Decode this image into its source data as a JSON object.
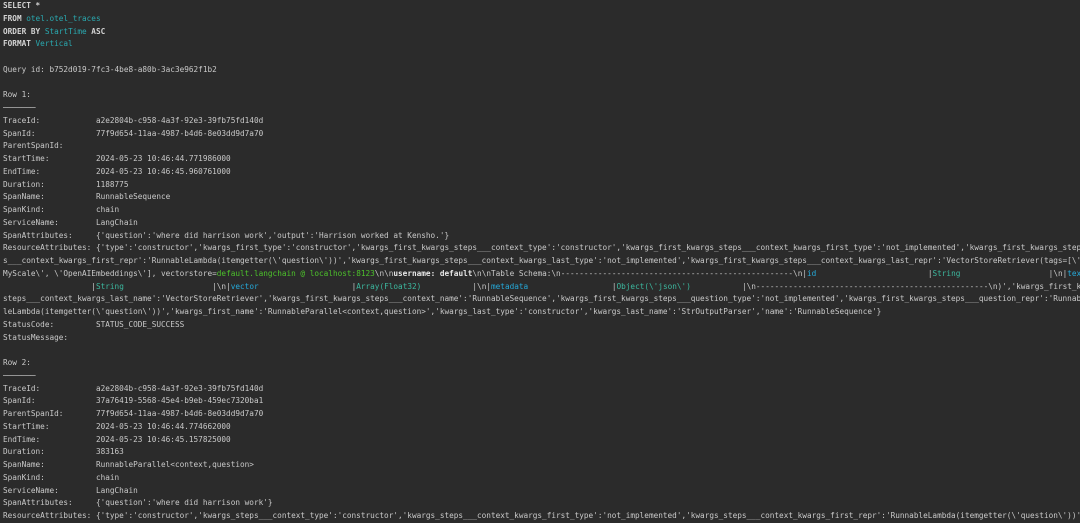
{
  "query": {
    "lines": [
      [
        [
          "SELECT *",
          "kw"
        ]
      ],
      [
        [
          "FROM ",
          "kw"
        ],
        [
          "otel.otel_traces",
          "id"
        ]
      ],
      [
        [
          "ORDER BY ",
          "kw"
        ],
        [
          "StartTime",
          "id"
        ],
        [
          " ASC",
          "kw"
        ]
      ],
      [
        [
          "FORMAT ",
          "kw"
        ],
        [
          "Vertical",
          "id"
        ]
      ],
      [
        [
          "",
          ""
        ]
      ],
      [
        [
          "Query id: b752d019-7fc3-4be8-a80b-3ac3e962f1b2",
          ""
        ]
      ],
      [
        [
          "",
          ""
        ]
      ],
      [
        [
          "Row 1:",
          ""
        ]
      ],
      [
        [
          "───────",
          ""
        ]
      ],
      [
        [
          "TraceId:            a2e2804b-c958-4a3f-92e3-39fb75fd140d",
          ""
        ]
      ],
      [
        [
          "SpanId:             77f9d654-11aa-4987-b4d6-8e03dd9d7a70",
          ""
        ]
      ],
      [
        [
          "ParentSpanId:",
          ""
        ]
      ],
      [
        [
          "StartTime:          2024-05-23 10:46:44.771986000",
          ""
        ]
      ],
      [
        [
          "EndTime:            2024-05-23 10:46:45.960761000",
          ""
        ]
      ],
      [
        [
          "Duration:           1188775",
          ""
        ]
      ],
      [
        [
          "SpanName:           RunnableSequence",
          ""
        ]
      ],
      [
        [
          "SpanKind:           chain",
          ""
        ]
      ],
      [
        [
          "ServiceName:        LangChain",
          ""
        ]
      ],
      [
        [
          "SpanAttributes:     {'question':'where did harrison work','output':'Harrison worked at Kensho.'}",
          ""
        ]
      ],
      [
        [
          "ResourceAttributes: {'type':'constructor','kwargs_first_type':'constructor','kwargs_first_kwargs_steps___context_type':'constructor','kwargs_first_kwargs_steps___context_kwargs_first_type':'not_implemented','kwargs_first_kwargs_steps",
          ""
        ]
      ],
      [
        [
          "s___context_kwargs_first_repr':'RunnableLambda(itemgetter(\\'question\\'))','kwargs_first_kwargs_steps___context_kwargs_last_type':'not_implemented','kwargs_first_kwargs_steps___context_kwargs_last_repr':'VectorStoreRetriever(tags=[\\'",
          ""
        ]
      ],
      [
        [
          "MyScale\\', \\'OpenAIEmbeddings\\'], vectorstore=",
          ""
        ],
        [
          "default.langchain @ localhost:8123",
          "gr"
        ],
        [
          "\\n\\n",
          ""
        ],
        [
          "username: default",
          "bd"
        ],
        [
          "\\n\\nTable Schema:\\n--------------------------------------------------\\n|",
          ""
        ],
        [
          "id",
          "cy"
        ],
        [
          "                        |",
          ""
        ],
        [
          "String",
          "st"
        ],
        [
          "                   |\\n|",
          ""
        ],
        [
          "text",
          "cy"
        ]
      ],
      [
        [
          "                   |",
          ""
        ],
        [
          "String",
          "st"
        ],
        [
          "                   |\\n|",
          ""
        ],
        [
          "vector",
          "cy"
        ],
        [
          "                    |",
          ""
        ],
        [
          "Array(Float32)",
          "st"
        ],
        [
          "           |\\n|",
          ""
        ],
        [
          "metadata",
          "cy"
        ],
        [
          "                  |",
          ""
        ],
        [
          "Object(\\'json\\')",
          "st"
        ],
        [
          "           |\\n--------------------------------------------------\\n)','kwargs_first_kwargs_",
          ""
        ]
      ],
      [
        [
          "steps___context_kwargs_last_name':'VectorStoreRetriever','kwargs_first_kwargs_steps___context_name':'RunnableSequence','kwargs_first_kwargs_steps___question_type':'not_implemented','kwargs_first_kwargs_steps___question_repr':'Runnab",
          ""
        ]
      ],
      [
        [
          "leLambda(itemgetter(\\'question\\'))','kwargs_first_name':'RunnableParallel<context,question>','kwargs_last_type':'constructor','kwargs_last_name':'StrOutputParser','name':'RunnableSequence'}",
          ""
        ]
      ],
      [
        [
          "StatusCode:         STATUS_CODE_SUCCESS",
          ""
        ]
      ],
      [
        [
          "StatusMessage:",
          ""
        ]
      ],
      [
        [
          "",
          ""
        ]
      ],
      [
        [
          "Row 2:",
          ""
        ]
      ],
      [
        [
          "───────",
          ""
        ]
      ],
      [
        [
          "TraceId:            a2e2804b-c958-4a3f-92e3-39fb75fd140d",
          ""
        ]
      ],
      [
        [
          "SpanId:             37a76419-5568-45e4-b9eb-459ec7320ba1",
          ""
        ]
      ],
      [
        [
          "ParentSpanId:       77f9d654-11aa-4987-b4d6-8e03dd9d7a70",
          ""
        ]
      ],
      [
        [
          "StartTime:          2024-05-23 10:46:44.774662000",
          ""
        ]
      ],
      [
        [
          "EndTime:            2024-05-23 10:46:45.157825000",
          ""
        ]
      ],
      [
        [
          "Duration:           383163",
          ""
        ]
      ],
      [
        [
          "SpanName:           RunnableParallel<context,question>",
          ""
        ]
      ],
      [
        [
          "SpanKind:           chain",
          ""
        ]
      ],
      [
        [
          "ServiceName:        LangChain",
          ""
        ]
      ],
      [
        [
          "SpanAttributes:     {'question':'where did harrison work'}",
          ""
        ]
      ],
      [
        [
          "ResourceAttributes: {'type':'constructor','kwargs_steps___context_type':'constructor','kwargs_steps___context_kwargs_first_type':'not_implemented','kwargs_steps___context_kwargs_first_repr':'RunnableLambda(itemgetter(\\'question\\'))'",
          ""
        ]
      ]
    ]
  }
}
